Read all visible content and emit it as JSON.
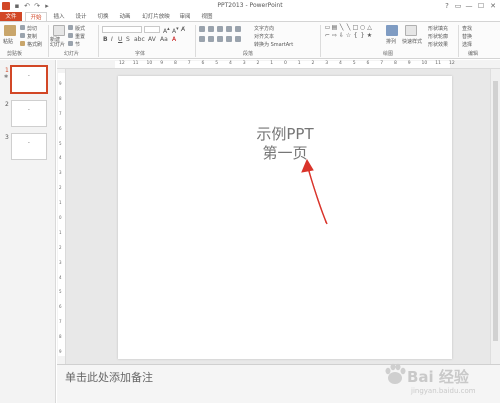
{
  "window": {
    "title": "PPT2013 - PowerPoint",
    "quick_access": [
      "save-icon",
      "undo-icon",
      "redo-icon",
      "start-slideshow-icon"
    ],
    "controls": {
      "help": "?",
      "restore": "▭",
      "minimize": "—",
      "maximize": "☐",
      "close": "✕"
    }
  },
  "tabs": [
    {
      "label": "文件",
      "name": "tab-file"
    },
    {
      "label": "开始",
      "name": "tab-home"
    },
    {
      "label": "插入",
      "name": "tab-insert"
    },
    {
      "label": "设计",
      "name": "tab-design"
    },
    {
      "label": "切换",
      "name": "tab-transitions"
    },
    {
      "label": "动画",
      "name": "tab-animations"
    },
    {
      "label": "幻灯片放映",
      "name": "tab-slideshow"
    },
    {
      "label": "审阅",
      "name": "tab-review"
    },
    {
      "label": "视图",
      "name": "tab-view"
    }
  ],
  "ribbon": {
    "clipboard": {
      "paste": "粘贴",
      "cut": "剪切",
      "copy": "复制",
      "format_painter": "格式刷",
      "group": "剪贴板"
    },
    "slides": {
      "new_slide": "新建\n幻灯片",
      "layout": "版式",
      "reset": "重置",
      "section": "节",
      "group": "幻灯片"
    },
    "font": {
      "group": "字体"
    },
    "paragraph": {
      "text_direction": "文字方向",
      "align_text": "对齐文本",
      "smartart": "转换为 SmartArt",
      "group": "段落"
    },
    "drawing": {
      "arrange": "排列",
      "quick_styles": "快速样式",
      "shape_fill": "形状填充",
      "shape_outline": "形状轮廓",
      "shape_effects": "形状效果",
      "group": "绘图"
    },
    "editing": {
      "find": "查找",
      "replace": "替换",
      "select": "选择",
      "group": "编辑"
    }
  },
  "thumbnails": [
    {
      "number": "1",
      "active": true
    },
    {
      "number": "2",
      "active": false
    },
    {
      "number": "3",
      "active": false
    }
  ],
  "ruler": {
    "horizontal_ticks": [
      "12",
      "11",
      "10",
      "9",
      "8",
      "7",
      "6",
      "5",
      "4",
      "3",
      "2",
      "1",
      "0",
      "1",
      "2",
      "3",
      "4",
      "5",
      "6",
      "7",
      "8",
      "9",
      "10",
      "11",
      "12"
    ],
    "vertical_ticks": [
      "9",
      "8",
      "7",
      "6",
      "5",
      "4",
      "3",
      "2",
      "1",
      "0",
      "1",
      "2",
      "3",
      "4",
      "5",
      "6",
      "7",
      "8",
      "9"
    ]
  },
  "slide": {
    "title": "示例PPT",
    "subtitle": "第一页"
  },
  "notes": {
    "placeholder": "单击此处添加备注"
  },
  "watermark": {
    "text": "Bai 经验",
    "sub": "jingyan.baidu.com"
  },
  "colors": {
    "accent": "#d24726",
    "annotation_arrow": "#d9342b"
  }
}
